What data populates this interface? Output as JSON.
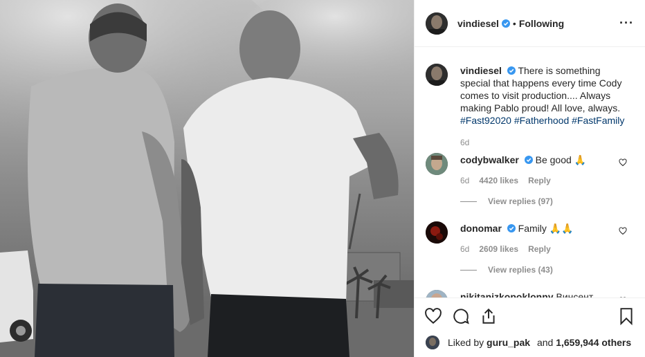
{
  "post": {
    "author": "vindiesel",
    "follow_status": "Following",
    "separator": "•",
    "more": "···",
    "caption_text": "There is something special that happens every time Cody comes to visit production.... Always making Pablo proud! All love, always.",
    "hashtags": [
      "#Fast92020",
      "#Fatherhood",
      "#FastFamily"
    ],
    "caption_age": "6d"
  },
  "comments": [
    {
      "user": "codybwalker",
      "text": "Be good 🙏",
      "age": "6d",
      "likes": "4420 likes",
      "reply": "Reply",
      "view_replies": "View replies (97)"
    },
    {
      "user": "donomar",
      "text": "Family 🙏🙏",
      "age": "6d",
      "likes": "2609 likes",
      "reply": "Reply",
      "view_replies": "View replies (43)"
    },
    {
      "user": "nikitanizkopoklonny",
      "text": "Винсент,"
    }
  ],
  "likes_bar": {
    "prefix": "Liked by",
    "liker": "guru_pak",
    "and": "and",
    "count": "1,659,944 others"
  },
  "icons": [
    "verified-badge-icon",
    "heart-icon",
    "comment-icon",
    "share-icon",
    "bookmark-icon"
  ],
  "colors": {
    "verified": "#3897f0",
    "hashtag": "#00376b",
    "meta": "#8e8e8e",
    "border": "#efefef"
  }
}
